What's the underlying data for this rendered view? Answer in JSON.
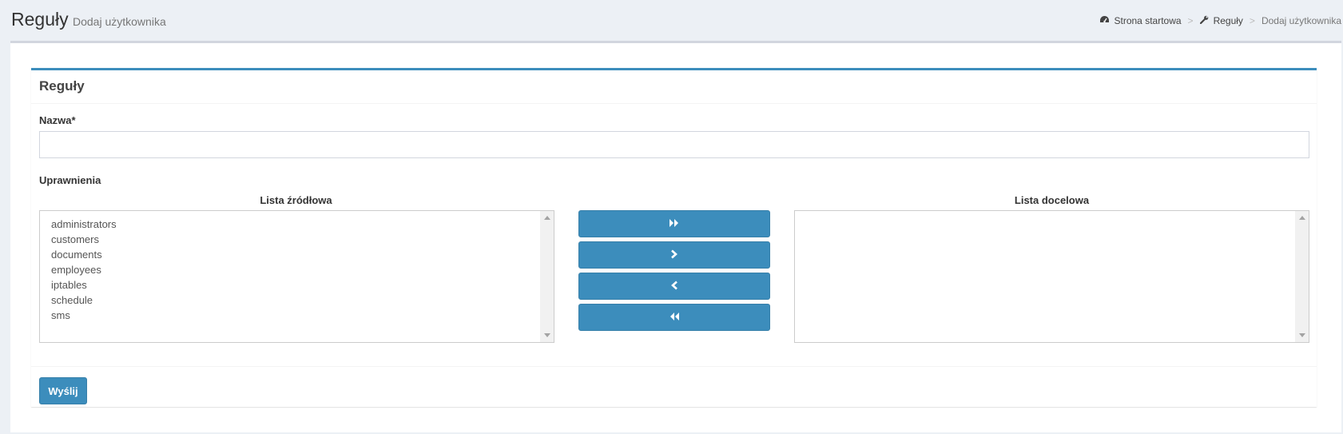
{
  "header": {
    "title": "Reguły",
    "subtitle": "Dodaj użytkownika"
  },
  "breadcrumb": {
    "items": [
      {
        "label": "Strona startowa",
        "icon": "dashboard-icon"
      },
      {
        "label": "Reguły",
        "icon": "wrench-icon"
      },
      {
        "label": "Dodaj użytkownika"
      }
    ],
    "separator": ">"
  },
  "box": {
    "title": "Reguły"
  },
  "form": {
    "name_label": "Nazwa*",
    "name_value": "",
    "permissions_label": "Uprawnienia",
    "source_list_title": "Lista źródłowa",
    "target_list_title": "Lista docelowa",
    "source_items": [
      "administrators",
      "customers",
      "documents",
      "employees",
      "iptables",
      "schedule",
      "sms"
    ],
    "target_items": [],
    "submit_label": "Wyślij"
  },
  "move_buttons": {
    "move_all_right_icon": "double-chevron-right-icon",
    "move_right_icon": "chevron-right-icon",
    "move_left_icon": "chevron-left-icon",
    "move_all_left_icon": "double-chevron-left-icon"
  },
  "colors": {
    "accent": "#3c8dbc",
    "background": "#ecf0f5"
  }
}
